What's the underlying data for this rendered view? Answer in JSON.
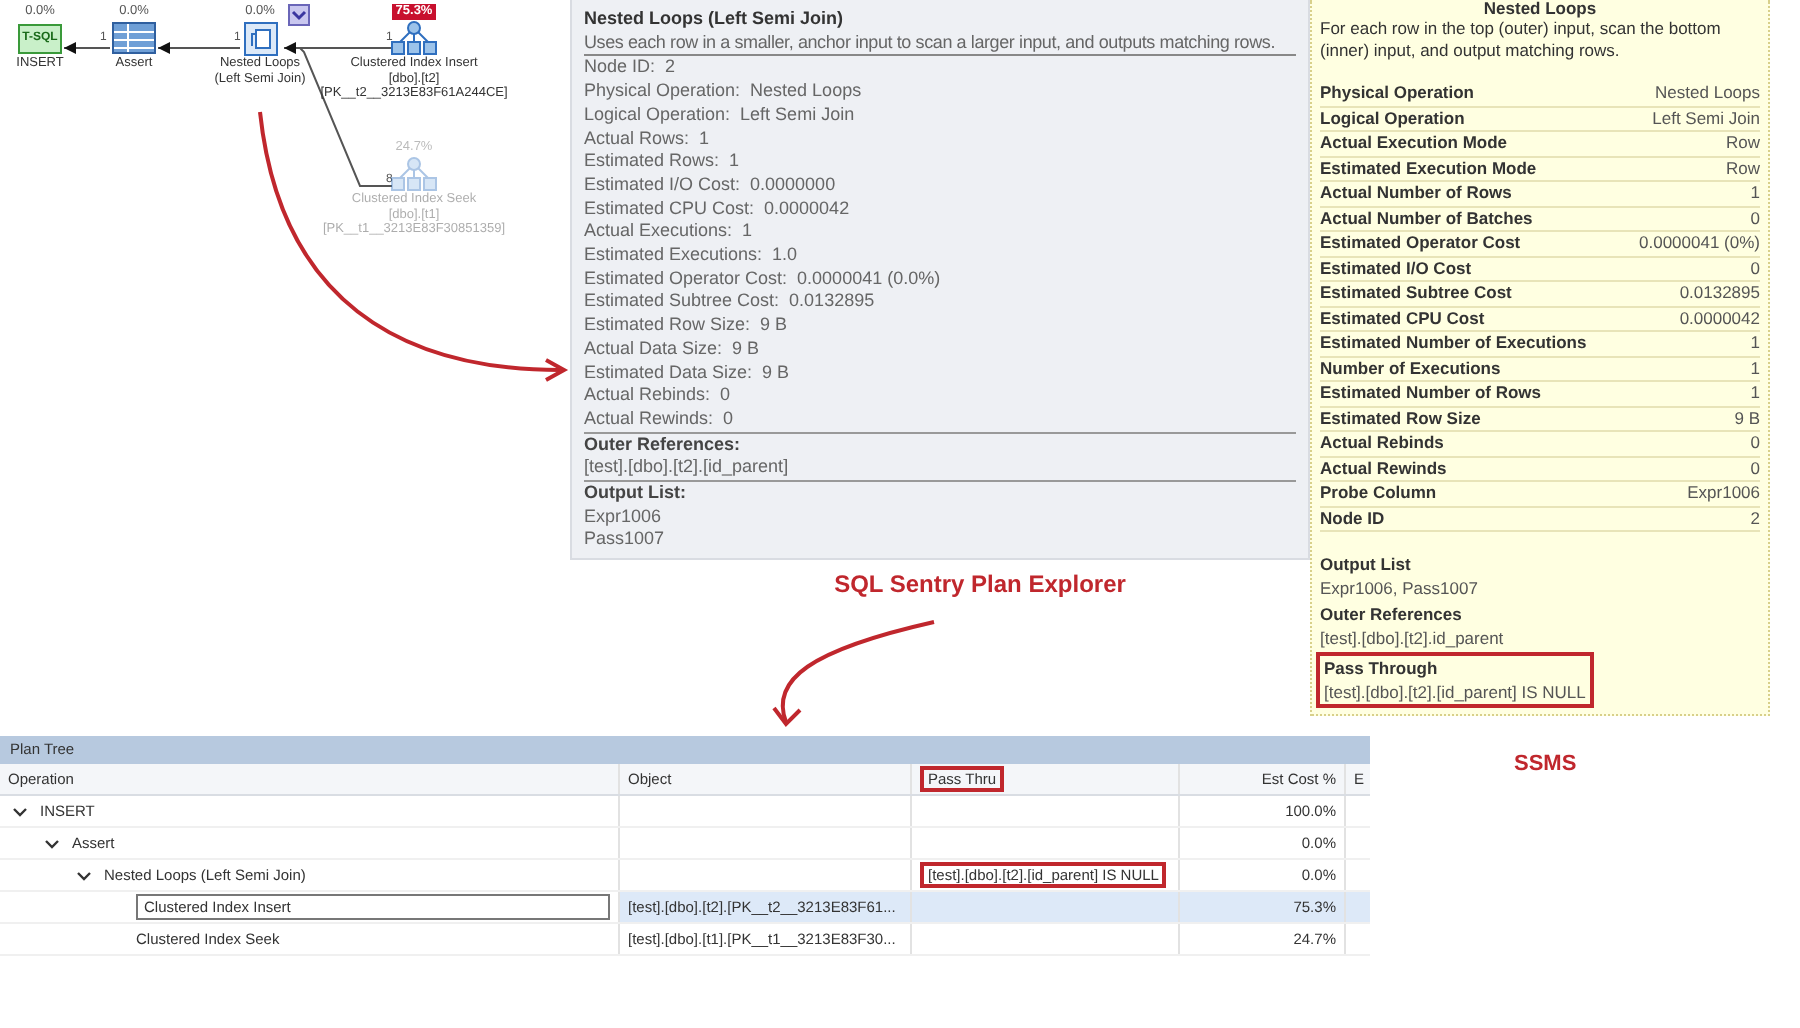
{
  "plan_diagram": {
    "nodes": [
      {
        "kind": "tsql",
        "cost": "0.0%",
        "cost_alert": false,
        "dimmed": false,
        "icon_text": "T-SQL",
        "lines": [
          "INSERT"
        ]
      },
      {
        "kind": "assert",
        "cost": "0.0%",
        "cost_alert": false,
        "dimmed": false,
        "lines": [
          "Assert"
        ]
      },
      {
        "kind": "nested_loops",
        "cost": "0.0%",
        "cost_alert": false,
        "dimmed": false,
        "lines": [
          "Nested Loops",
          "(Left Semi Join)"
        ]
      },
      {
        "kind": "index_insert",
        "cost": "75.3%",
        "cost_alert": true,
        "dimmed": false,
        "lines": [
          "Clustered Index Insert",
          "[dbo].[t2]",
          "[PK__t2__3213E83F61A244CE]"
        ]
      },
      {
        "kind": "index_seek",
        "cost": "24.7%",
        "cost_alert": false,
        "dimmed": true,
        "lines": [
          "Clustered Index Seek",
          "[dbo].[t1]",
          "[PK__t1__3213E83F30851359]"
        ]
      }
    ],
    "edges": [
      {
        "rows": "1"
      },
      {
        "rows": "1"
      },
      {
        "rows": "1"
      },
      {
        "rows": "8"
      }
    ]
  },
  "plan_explorer_tooltip": {
    "title": "Nested Loops (Left Semi Join)",
    "description": "Uses each row in a smaller, anchor input to scan a larger input, and outputs matching rows.",
    "properties": [
      {
        "label": "Node ID:",
        "value": "2"
      },
      {
        "label": "Physical Operation:",
        "value": "Nested Loops"
      },
      {
        "label": "Logical Operation:",
        "value": "Left Semi Join"
      },
      {
        "label": "Actual Rows:",
        "value": "1"
      },
      {
        "label": "Estimated Rows:",
        "value": "1"
      },
      {
        "label": "Estimated I/O Cost:",
        "value": "0.0000000"
      },
      {
        "label": "Estimated CPU Cost:",
        "value": "0.0000042"
      },
      {
        "label": "Actual Executions:",
        "value": "1"
      },
      {
        "label": "Estimated Executions:",
        "value": "1.0"
      },
      {
        "label": "Estimated Operator Cost:",
        "value": "0.0000041 (0.0%)"
      },
      {
        "label": "Estimated Subtree Cost:",
        "value": "0.0132895"
      },
      {
        "label": "Estimated Row Size:",
        "value": "9 B"
      },
      {
        "label": "Actual Data Size:",
        "value": "9 B"
      },
      {
        "label": "Estimated Data Size:",
        "value": "9 B"
      },
      {
        "label": "Actual Rebinds:",
        "value": "0"
      },
      {
        "label": "Actual Rewinds:",
        "value": "0"
      }
    ],
    "sections": [
      {
        "heading": "Outer References:",
        "values": [
          "[test].[dbo].[t2].[id_parent]"
        ]
      },
      {
        "heading": "Output List:",
        "values": [
          "Expr1006",
          "Pass1007"
        ]
      }
    ]
  },
  "plan_explorer_caption": "SQL Sentry Plan Explorer",
  "ssms_tooltip": {
    "title": "Nested Loops",
    "description": "For each row in the top (outer) input, scan the bottom (inner) input, and output matching rows.",
    "properties": [
      {
        "label": "Physical Operation",
        "value": "Nested Loops"
      },
      {
        "label": "Logical Operation",
        "value": "Left Semi Join"
      },
      {
        "label": "Actual Execution Mode",
        "value": "Row"
      },
      {
        "label": "Estimated Execution Mode",
        "value": "Row"
      },
      {
        "label": "Actual Number of Rows",
        "value": "1"
      },
      {
        "label": "Actual Number of Batches",
        "value": "0"
      },
      {
        "label": "Estimated Operator Cost",
        "value": "0.0000041 (0%)"
      },
      {
        "label": "Estimated I/O Cost",
        "value": "0"
      },
      {
        "label": "Estimated Subtree Cost",
        "value": "0.0132895"
      },
      {
        "label": "Estimated CPU Cost",
        "value": "0.0000042"
      },
      {
        "label": "Estimated Number of Executions",
        "value": "1"
      },
      {
        "label": "Number of Executions",
        "value": "1"
      },
      {
        "label": "Estimated Number of Rows",
        "value": "1"
      },
      {
        "label": "Estimated Row Size",
        "value": "9 B"
      },
      {
        "label": "Actual Rebinds",
        "value": "0"
      },
      {
        "label": "Actual Rewinds",
        "value": "0"
      },
      {
        "label": "Probe Column",
        "value": "Expr1006"
      },
      {
        "label": "Node ID",
        "value": "2"
      }
    ],
    "sections": [
      {
        "heading": "Output List",
        "text": "Expr1006, Pass1007",
        "highlighted": false
      },
      {
        "heading": "Outer References",
        "text": "[test].[dbo].[t2].id_parent",
        "highlighted": false
      },
      {
        "heading": "Pass Through",
        "text": "[test].[dbo].[t2].[id_parent] IS NULL",
        "highlighted": true
      }
    ]
  },
  "ssms_caption": "SSMS",
  "plan_tree": {
    "title": "Plan Tree",
    "columns": [
      {
        "label": "Operation",
        "highlighted": false
      },
      {
        "label": "Object",
        "highlighted": false
      },
      {
        "label": "Pass Thru",
        "highlighted": true
      },
      {
        "label": "Est Cost %",
        "highlighted": false
      },
      {
        "label": "E",
        "highlighted": false
      }
    ],
    "rows": [
      {
        "operation": "INSERT",
        "est_cost": "100.0%",
        "expanded": true,
        "selected": false,
        "children": [
          {
            "operation": "Assert",
            "est_cost": "0.0%",
            "expanded": true,
            "selected": false,
            "children": [
              {
                "operation": "Nested Loops (Left Semi Join)",
                "pass_thru": "[test].[dbo].[t2].[id_parent] IS NULL",
                "pass_thru_highlighted": true,
                "est_cost": "0.0%",
                "expanded": true,
                "selected": false,
                "children": [
                  {
                    "operation": "Clustered Index Insert",
                    "object": "[test].[dbo].[t2].[PK__t2__3213E83F61...",
                    "est_cost": "75.3%",
                    "selected": true
                  },
                  {
                    "operation": "Clustered Index Seek",
                    "object": "[test].[dbo].[t1].[PK__t1__3213E83F30...",
                    "est_cost": "24.7%",
                    "selected": false
                  }
                ]
              }
            ]
          }
        ]
      }
    ]
  }
}
